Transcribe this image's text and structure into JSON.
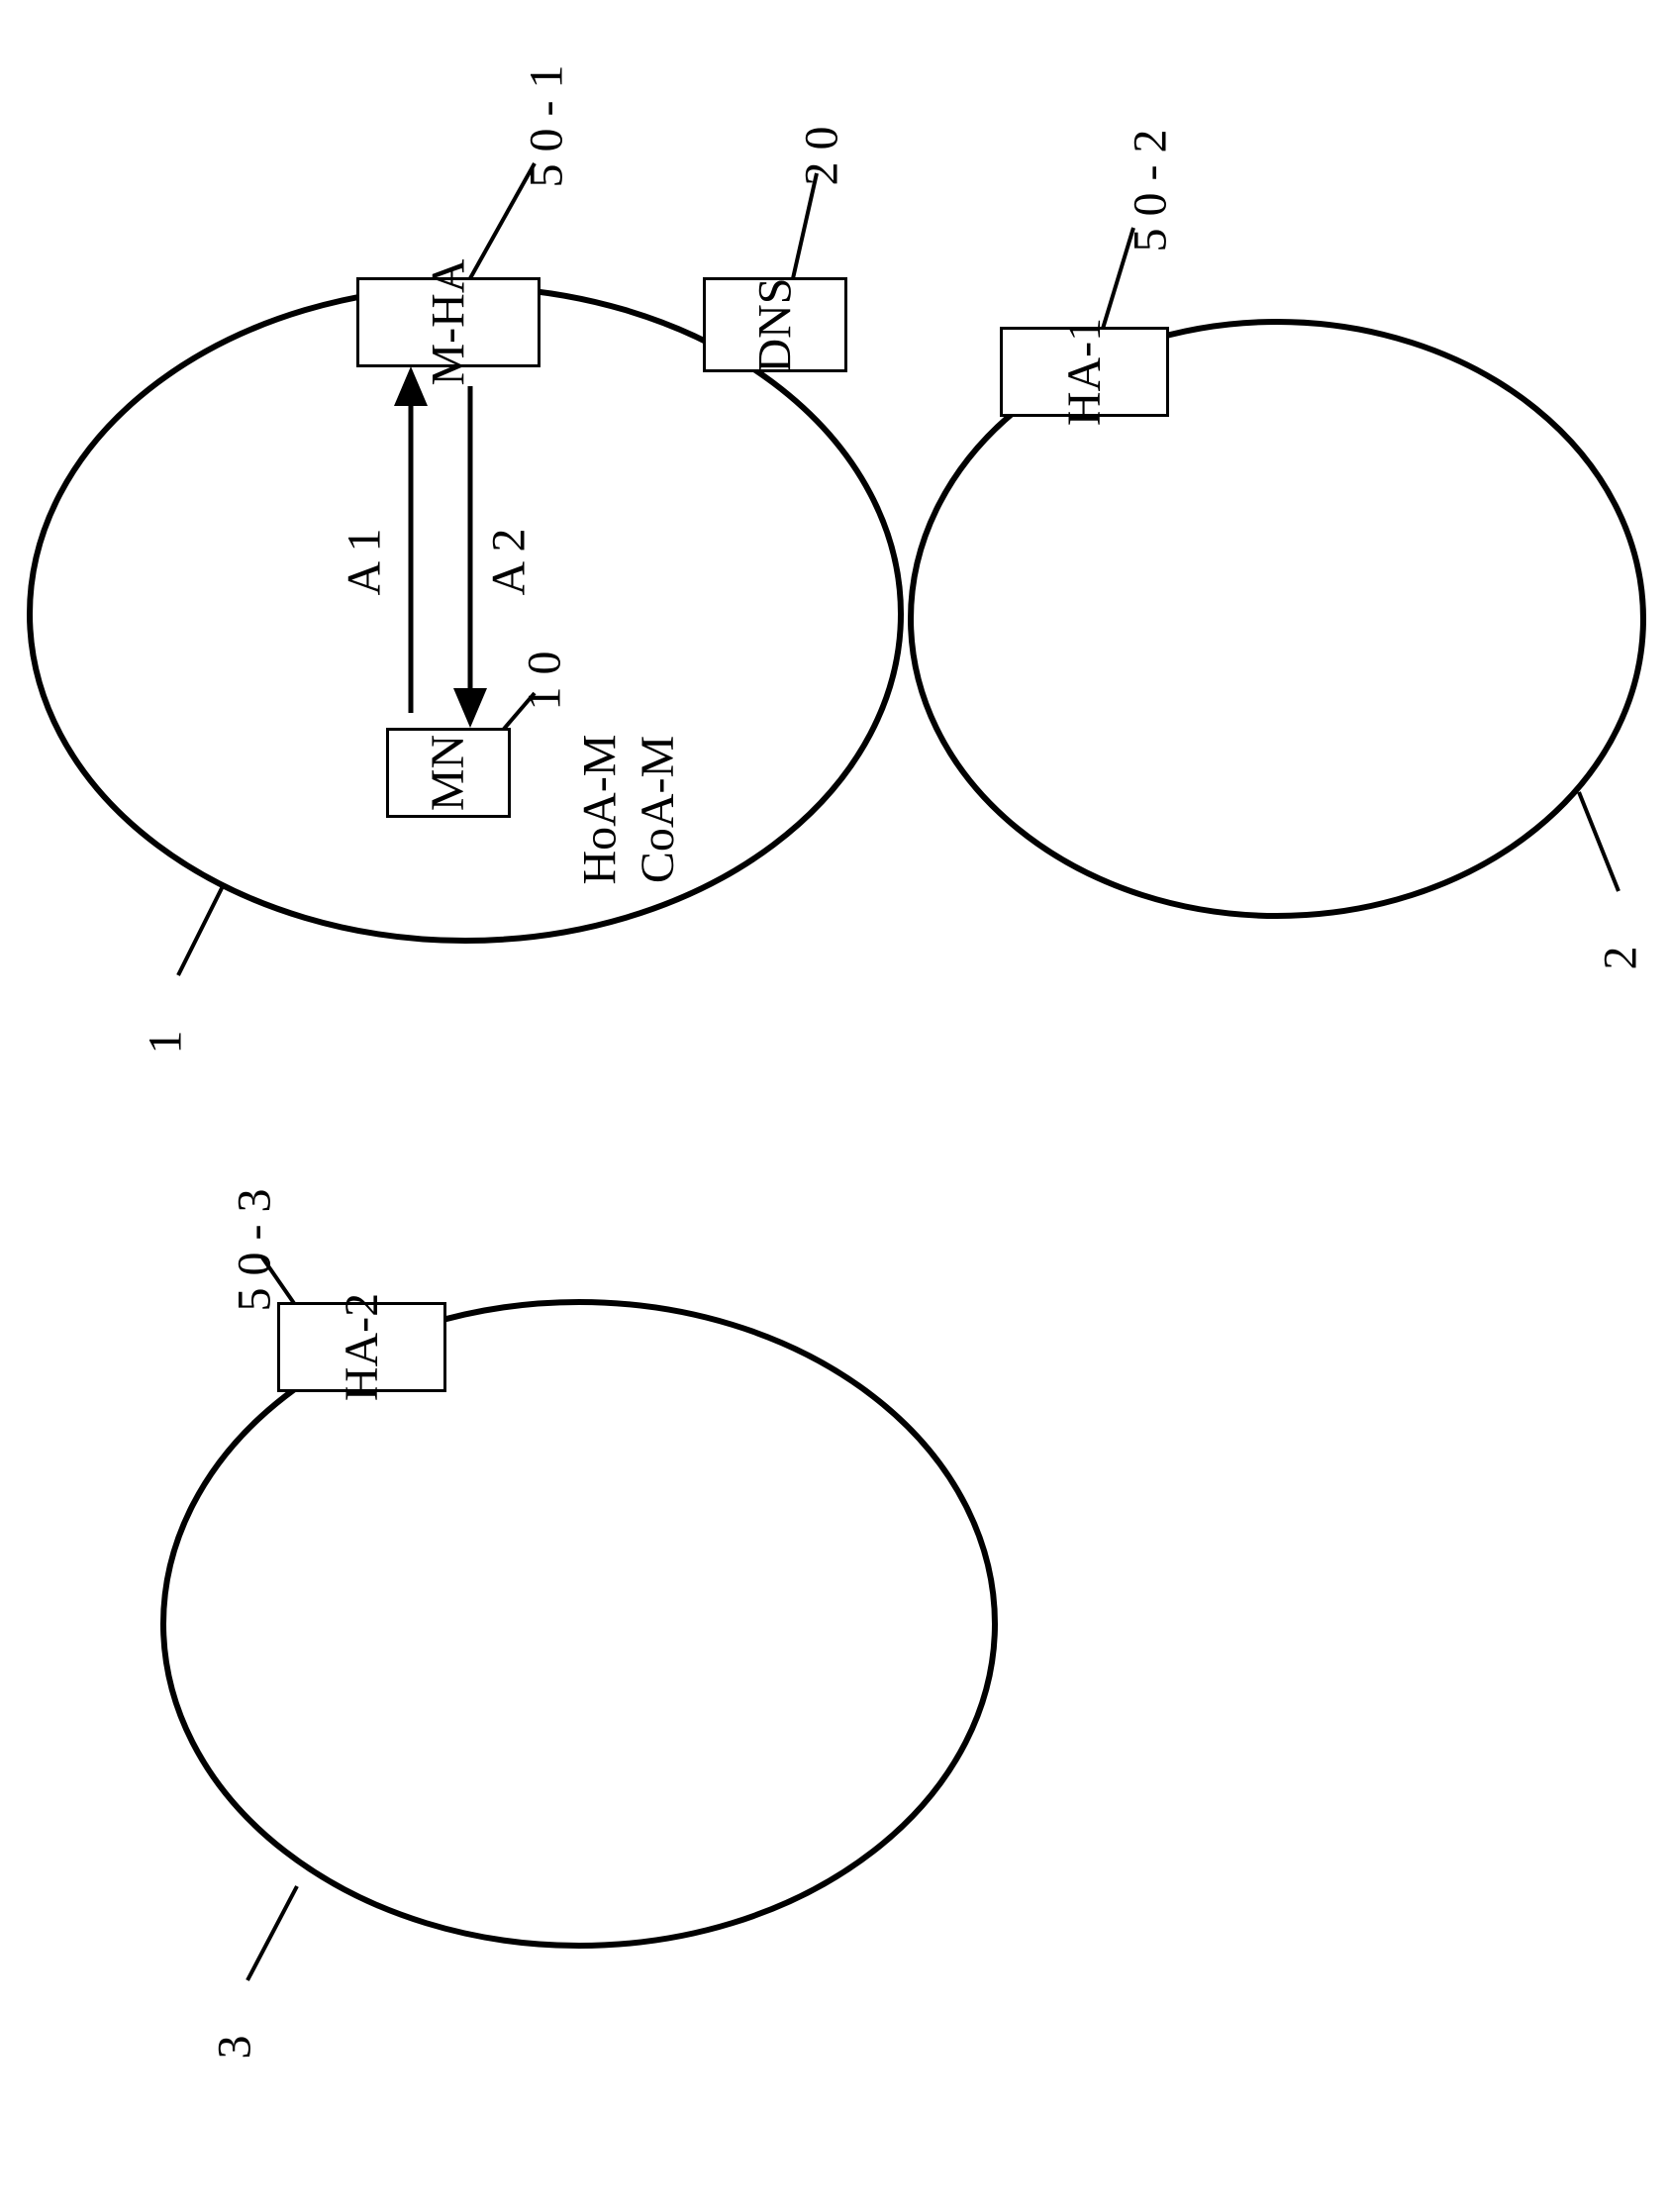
{
  "agents": {
    "mha": {
      "label": "M-HA",
      "ref": "5 0 - 1"
    },
    "dns": {
      "label": "DNS",
      "ref": "2 0"
    },
    "mn": {
      "label": "MN",
      "ref": "1 0",
      "addr1": "HoA-M",
      "addr2": "CoA-M"
    },
    "ha1": {
      "label": "HA-1",
      "ref": "5 0 - 2"
    },
    "ha2": {
      "label": "HA-2",
      "ref": "5 0 - 3"
    }
  },
  "networks": {
    "net1": {
      "ref": "1"
    },
    "net2": {
      "ref": "2"
    },
    "net3": {
      "ref": "3"
    }
  },
  "arrows": {
    "a1": "A 1",
    "a2": "A 2"
  }
}
